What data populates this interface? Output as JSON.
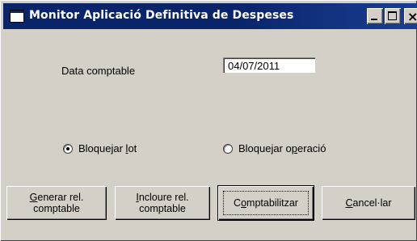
{
  "window": {
    "title": "Monitor Aplicació Definitiva de Despeses",
    "icon": "app-window-icon"
  },
  "titlebar_buttons": {
    "minimize": "minimize-icon",
    "maximize": "maximize-icon",
    "close_glyph": "×"
  },
  "form": {
    "date_label": "Data comptable",
    "date_value": "04/07/2011"
  },
  "options": {
    "lot": {
      "prefix": "Bloquejar ",
      "accel": "l",
      "suffix": "ot",
      "checked": true
    },
    "operacio": {
      "prefix": "Bloquejar o",
      "accel": "p",
      "suffix": "eració",
      "checked": false
    }
  },
  "buttons": {
    "generar": {
      "accel": "G",
      "rest": "enerar rel.\ncomptable"
    },
    "incloure": {
      "accel": "I",
      "rest": "ncloure rel.\ncomptable"
    },
    "comptabilitzar": {
      "prefix": "C",
      "accel": "o",
      "rest": "mptabilitzar"
    },
    "cancel": {
      "accel": "C",
      "rest": "ancel·lar"
    }
  },
  "colors": {
    "titlebar": "#0a246a",
    "face": "#d4d0c8"
  }
}
